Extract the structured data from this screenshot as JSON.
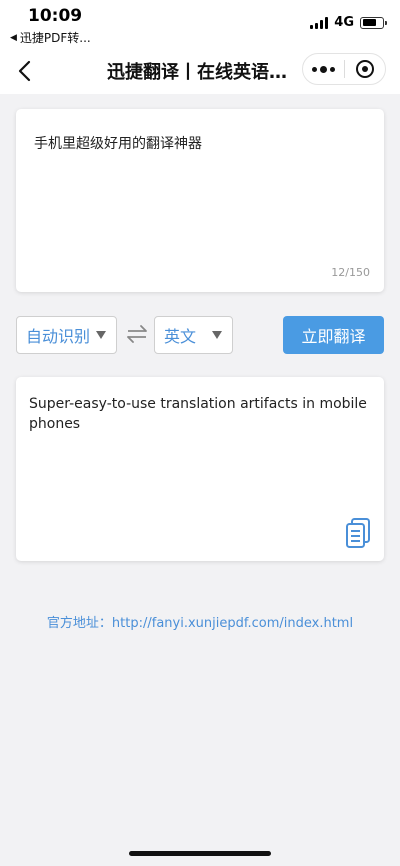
{
  "status_bar": {
    "time": "10:09",
    "back_app_label": "迅捷PDF转...",
    "network": "4G",
    "battery_fraction": 0.7
  },
  "nav": {
    "title": "迅捷翻译丨在线英语…"
  },
  "source": {
    "text": "手机里超级好用的翻译神器",
    "count": "12/150"
  },
  "controls": {
    "from_lang": "自动识别",
    "to_lang": "英文",
    "translate_label": "立即翻译"
  },
  "result": {
    "text": "Super-easy-to-use translation artifacts in mobile phones"
  },
  "footer": {
    "official_label": "官方地址：",
    "official_url": "http://fanyi.xunjiepdf.com/index.html"
  },
  "colors": {
    "accent": "#4a9be3",
    "link": "#4a8fd8",
    "background": "#f2f2f4"
  }
}
